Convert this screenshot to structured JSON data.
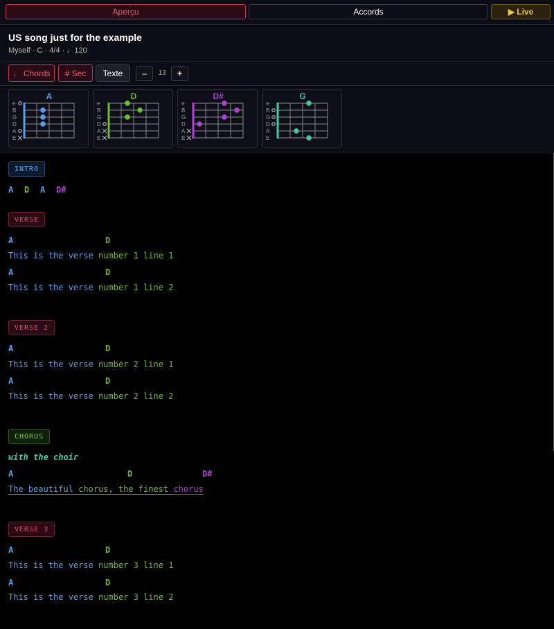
{
  "topbar": {
    "apercu": "Aperçu",
    "accords": "Accords",
    "live": "▶ Live"
  },
  "song": {
    "title": "US song just for the example",
    "meta": "Myself · C · 4/4 · ♩120"
  },
  "toolbar": {
    "chords": "♩ Chords",
    "sec": "# Sec",
    "texte": "Texte",
    "minus": "–",
    "font_size": "13",
    "plus": "+"
  },
  "strings": [
    "e",
    "B",
    "G",
    "D",
    "A",
    "E"
  ],
  "diagrams": [
    {
      "name": "A",
      "color": "#5b9ce6",
      "nut": true,
      "frets": [
        0,
        2,
        2,
        2,
        0,
        -1
      ],
      "string_states": [
        "o",
        "",
        "",
        "",
        "o",
        "x"
      ]
    },
    {
      "name": "D",
      "color": "#6fb83a",
      "nut": true,
      "frets": [
        2,
        3,
        2,
        0,
        -1,
        -1
      ],
      "string_states": [
        "",
        "",
        "",
        "o",
        "x",
        "x"
      ]
    },
    {
      "name": "D#",
      "color": "#b040d6",
      "nut": true,
      "frets": [
        3,
        4,
        3,
        1,
        -1,
        -1
      ],
      "string_states": [
        "",
        "",
        "",
        "",
        "x",
        "x"
      ]
    },
    {
      "name": "G",
      "color": "#3ec7a8",
      "nut": true,
      "frets": [
        3,
        0,
        0,
        0,
        2,
        3
      ],
      "string_states": [
        "",
        "o",
        "o",
        "o",
        "",
        ""
      ]
    }
  ],
  "sections": {
    "intro": {
      "label": "INTRO",
      "chords": [
        "A",
        "D",
        "A",
        "D#"
      ]
    },
    "verse": {
      "label": "VERSE",
      "lines": [
        {
          "c1": "A",
          "c2": "D",
          "t1": "This is the verse ",
          "t2": "number 1 line 1"
        },
        {
          "c1": "A",
          "c2": "D",
          "t1": "This is the verse ",
          "t2": "number 1 line 2"
        }
      ]
    },
    "verse2": {
      "label": "VERSE 2",
      "lines": [
        {
          "c1": "A",
          "c2": "D",
          "t1": "This is the verse ",
          "t2": "number 2 line 1"
        },
        {
          "c1": "A",
          "c2": "D",
          "t1": "This is the verse ",
          "t2": "number 2 line 2"
        }
      ]
    },
    "chorus": {
      "label": "CHORUS",
      "note": "with the choir",
      "chords": [
        "A",
        "D",
        "D#"
      ],
      "t1": "The beautiful ",
      "t2": "chorus, the finest ",
      "t3": "chorus"
    },
    "verse3": {
      "label": "VERSE 3",
      "lines": [
        {
          "c1": "A",
          "c2": "D",
          "t1": "This is the verse ",
          "t2": "number 3 line 1"
        },
        {
          "c1": "A",
          "c2": "D",
          "t1": "This is the verse ",
          "t2": "number 3 line 2"
        }
      ]
    }
  }
}
